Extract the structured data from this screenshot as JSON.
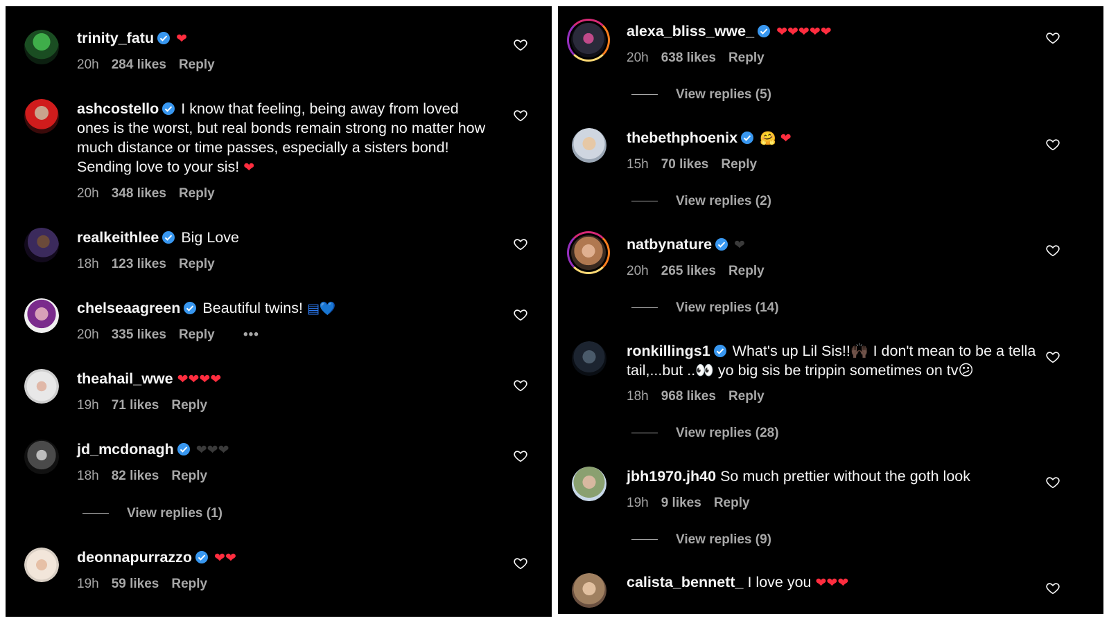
{
  "left": [
    {
      "user": "trinity_fatu",
      "text": "",
      "emoji": "❤",
      "emoji_class": "heart-red",
      "time": "20h",
      "likes": "284 likes",
      "reply": "Reply"
    },
    {
      "user": "ashcostello",
      "text": "I know that feeling, being away from loved ones is the worst, but real bonds remain strong no matter how much distance or time passes, especially a sisters bond! Sending love to your sis!",
      "emoji": "❤",
      "emoji_class": "heart-red",
      "time": "20h",
      "likes": "348 likes",
      "reply": "Reply"
    },
    {
      "user": "realkeithlee",
      "text": "Big Love",
      "emoji": "",
      "time": "18h",
      "likes": "123 likes",
      "reply": "Reply"
    },
    {
      "user": "chelseaagreen",
      "text": "Beautiful twins!",
      "emoji": "▤💙",
      "emoji_class": "heart-blue",
      "time": "20h",
      "likes": "335 likes",
      "reply": "Reply",
      "more": "•••"
    },
    {
      "user": "theahail_wwe",
      "text": "",
      "emoji": "❤❤❤❤",
      "emoji_class": "heart-red",
      "time": "19h",
      "likes": "71 likes",
      "reply": "Reply"
    },
    {
      "user": "jd_mcdonagh",
      "text": "",
      "emoji": "❤❤❤",
      "emoji_class": "heart-dark",
      "time": "18h",
      "likes": "82 likes",
      "reply": "Reply",
      "view_replies": "View replies (1)"
    },
    {
      "user": "deonnapurrazzo",
      "text": "",
      "emoji": "❤❤",
      "emoji_class": "heart-red",
      "time": "19h",
      "likes": "59 likes",
      "reply": "Reply"
    }
  ],
  "right": [
    {
      "user": "alexa_bliss_wwe_",
      "text": "",
      "emoji": "❤❤❤❤❤",
      "emoji_class": "heart-red",
      "time": "20h",
      "likes": "638 likes",
      "reply": "Reply",
      "view_replies": "View replies (5)"
    },
    {
      "user": "thebethphoenix",
      "text": "",
      "emoji": "🤗 ❤",
      "emoji_class": "heart-red",
      "time": "15h",
      "likes": "70 likes",
      "reply": "Reply",
      "view_replies": "View replies (2)"
    },
    {
      "user": "natbynature",
      "text": "",
      "emoji": "❤",
      "emoji_class": "heart-dark",
      "time": "20h",
      "likes": "265 likes",
      "reply": "Reply",
      "view_replies": "View replies (14)"
    },
    {
      "user": "ronkillings1",
      "text": "What's up Lil Sis!!🙌🏿 I don't mean to be a tella tail,...but ..👀 yo big sis be trippin sometimes on tv😕",
      "emoji": "",
      "time": "18h",
      "likes": "968 likes",
      "reply": "Reply",
      "view_replies": "View replies (28)"
    },
    {
      "user": "jbh1970.jh40",
      "text": "So much prettier without the goth look",
      "emoji": "",
      "time": "19h",
      "likes": "9 likes",
      "reply": "Reply",
      "view_replies": "View replies (9)"
    },
    {
      "user": "calista_bennett_",
      "text": "I love you",
      "emoji": "❤❤❤",
      "emoji_class": "heart-red",
      "time": "",
      "likes": "",
      "reply": ""
    }
  ],
  "colors": {
    "background": "#000000",
    "text": "#f5f5f5",
    "meta": "#a8a8a8",
    "verified": "#3897f0",
    "heart": "#ff2d3f"
  },
  "icons": {
    "verified": "verified-badge-icon",
    "like": "heart-outline-icon"
  }
}
